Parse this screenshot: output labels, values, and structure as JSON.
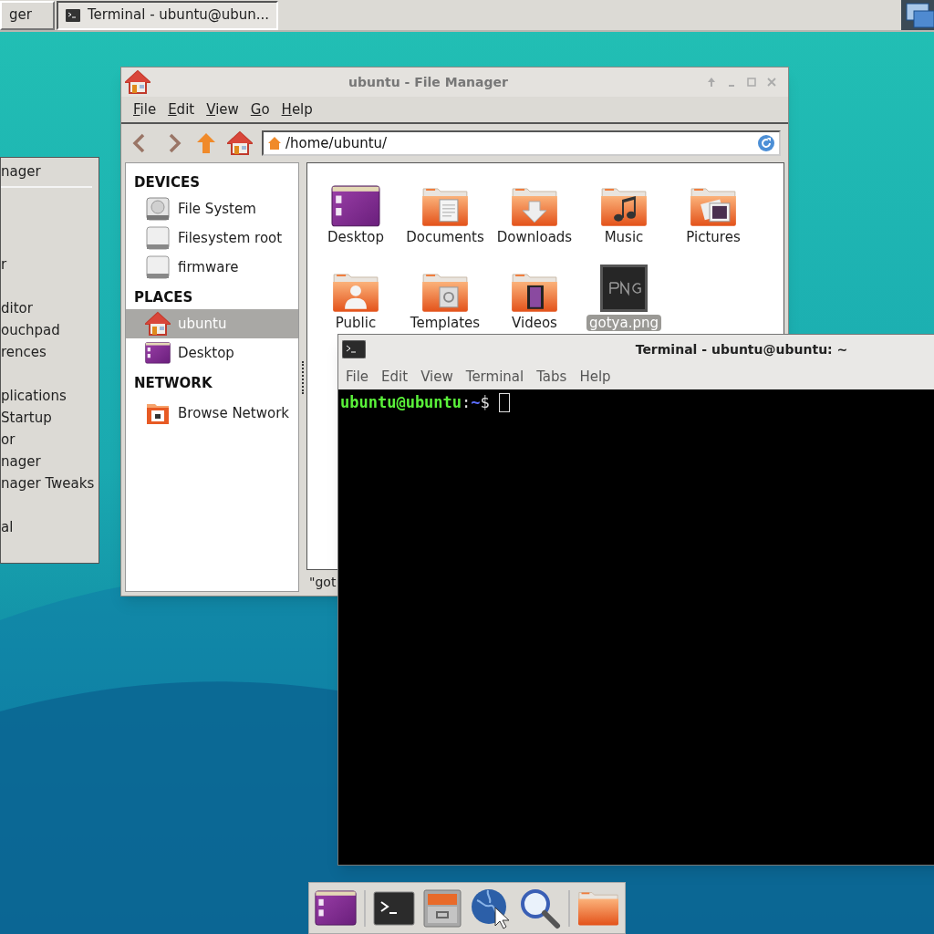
{
  "top_panel": {
    "tasks": [
      {
        "label": "ger",
        "selected": false,
        "kind": "plain"
      },
      {
        "label": "Terminal - ubuntu@ubun...",
        "selected": true,
        "kind": "terminal"
      }
    ]
  },
  "menu": {
    "header": "nager",
    "items": [
      "r",
      "ditor",
      "ouchpad",
      "rences",
      "plications",
      "Startup",
      "or",
      "nager",
      "nager Tweaks",
      "al"
    ]
  },
  "file_manager": {
    "title": "ubuntu - File Manager",
    "menu": [
      "File",
      "Edit",
      "View",
      "Go",
      "Help"
    ],
    "location": "/home/ubuntu/",
    "sidebar": [
      {
        "heading": "DEVICES",
        "items": [
          {
            "label": "File System",
            "kind": "harddisk",
            "selected": false
          },
          {
            "label": "Filesystem root",
            "kind": "drive",
            "selected": false
          },
          {
            "label": "firmware",
            "kind": "drive",
            "selected": false
          }
        ]
      },
      {
        "heading": "PLACES",
        "items": [
          {
            "label": "ubuntu",
            "kind": "home",
            "selected": true
          },
          {
            "label": "Desktop",
            "kind": "desktop",
            "selected": false
          }
        ]
      },
      {
        "heading": "NETWORK",
        "items": [
          {
            "label": "Browse Network",
            "kind": "network",
            "selected": false
          }
        ]
      }
    ],
    "files": [
      {
        "name": "Desktop",
        "kind": "desktop",
        "selected": false
      },
      {
        "name": "Documents",
        "kind": "documents",
        "selected": false
      },
      {
        "name": "Downloads",
        "kind": "downloads",
        "selected": false
      },
      {
        "name": "Music",
        "kind": "music",
        "selected": false
      },
      {
        "name": "Pictures",
        "kind": "pictures",
        "selected": false
      },
      {
        "name": "Public",
        "kind": "public",
        "selected": false
      },
      {
        "name": "Templates",
        "kind": "templates",
        "selected": false
      },
      {
        "name": "Videos",
        "kind": "videos",
        "selected": false
      },
      {
        "name": "gotya.png",
        "kind": "png",
        "selected": true
      }
    ],
    "status": "\"got"
  },
  "terminal": {
    "title": "Terminal - ubuntu@ubuntu: ~",
    "menu": [
      "File",
      "Edit",
      "View",
      "Terminal",
      "Tabs",
      "Help"
    ],
    "prompt": {
      "user_host": "ubuntu@ubuntu",
      "separator": ":",
      "path": "~",
      "symbol": "$"
    }
  }
}
